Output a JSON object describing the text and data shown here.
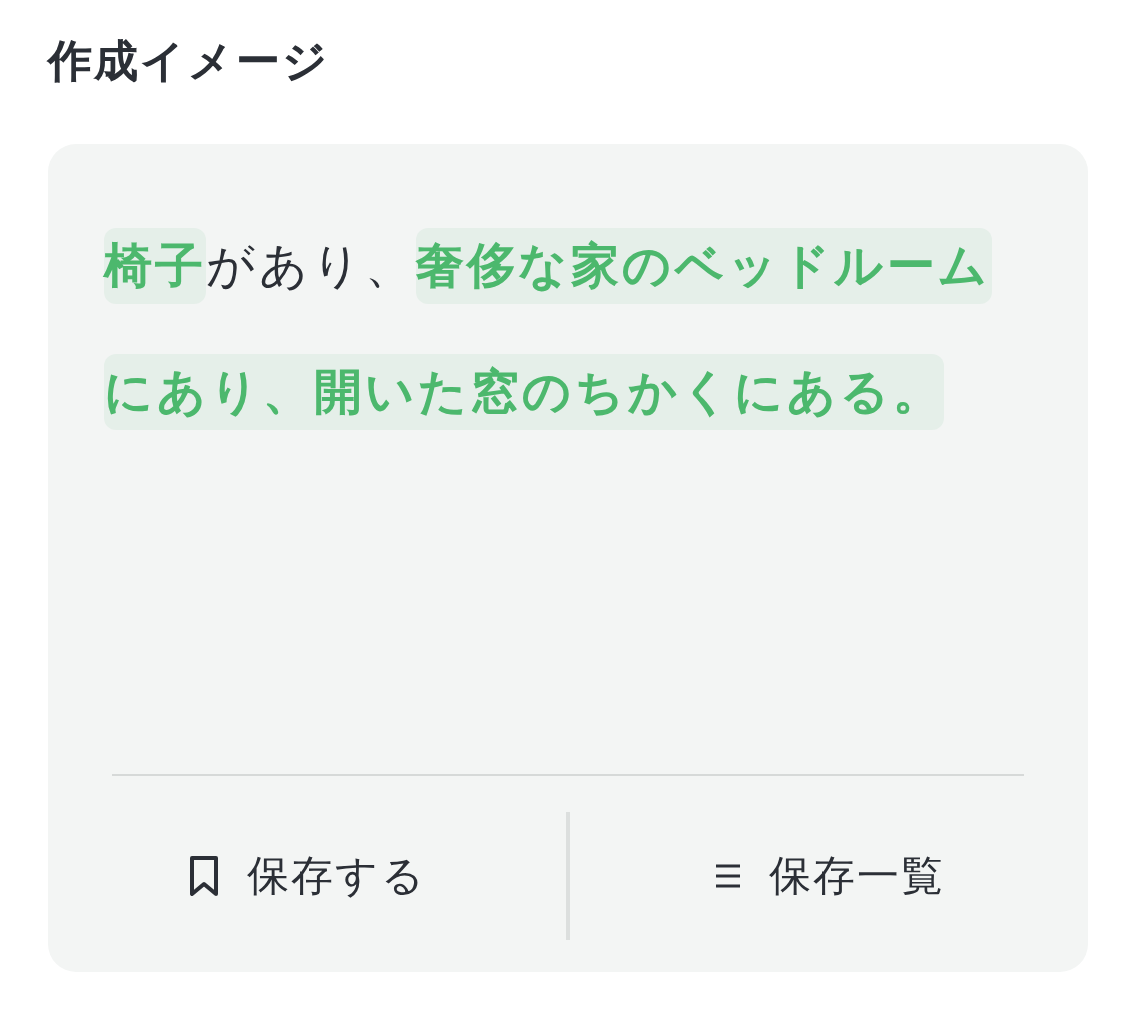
{
  "heading": "作成イメージ",
  "card": {
    "text": "**椅子**があり、**奢侈な家のベッドルームにあり、開いた窓のちかくにある。**",
    "buttons": [
      {
        "kind": "bookmark",
        "label": "保存する"
      },
      {
        "kind": "list",
        "label": "保存一覧"
      }
    ]
  }
}
